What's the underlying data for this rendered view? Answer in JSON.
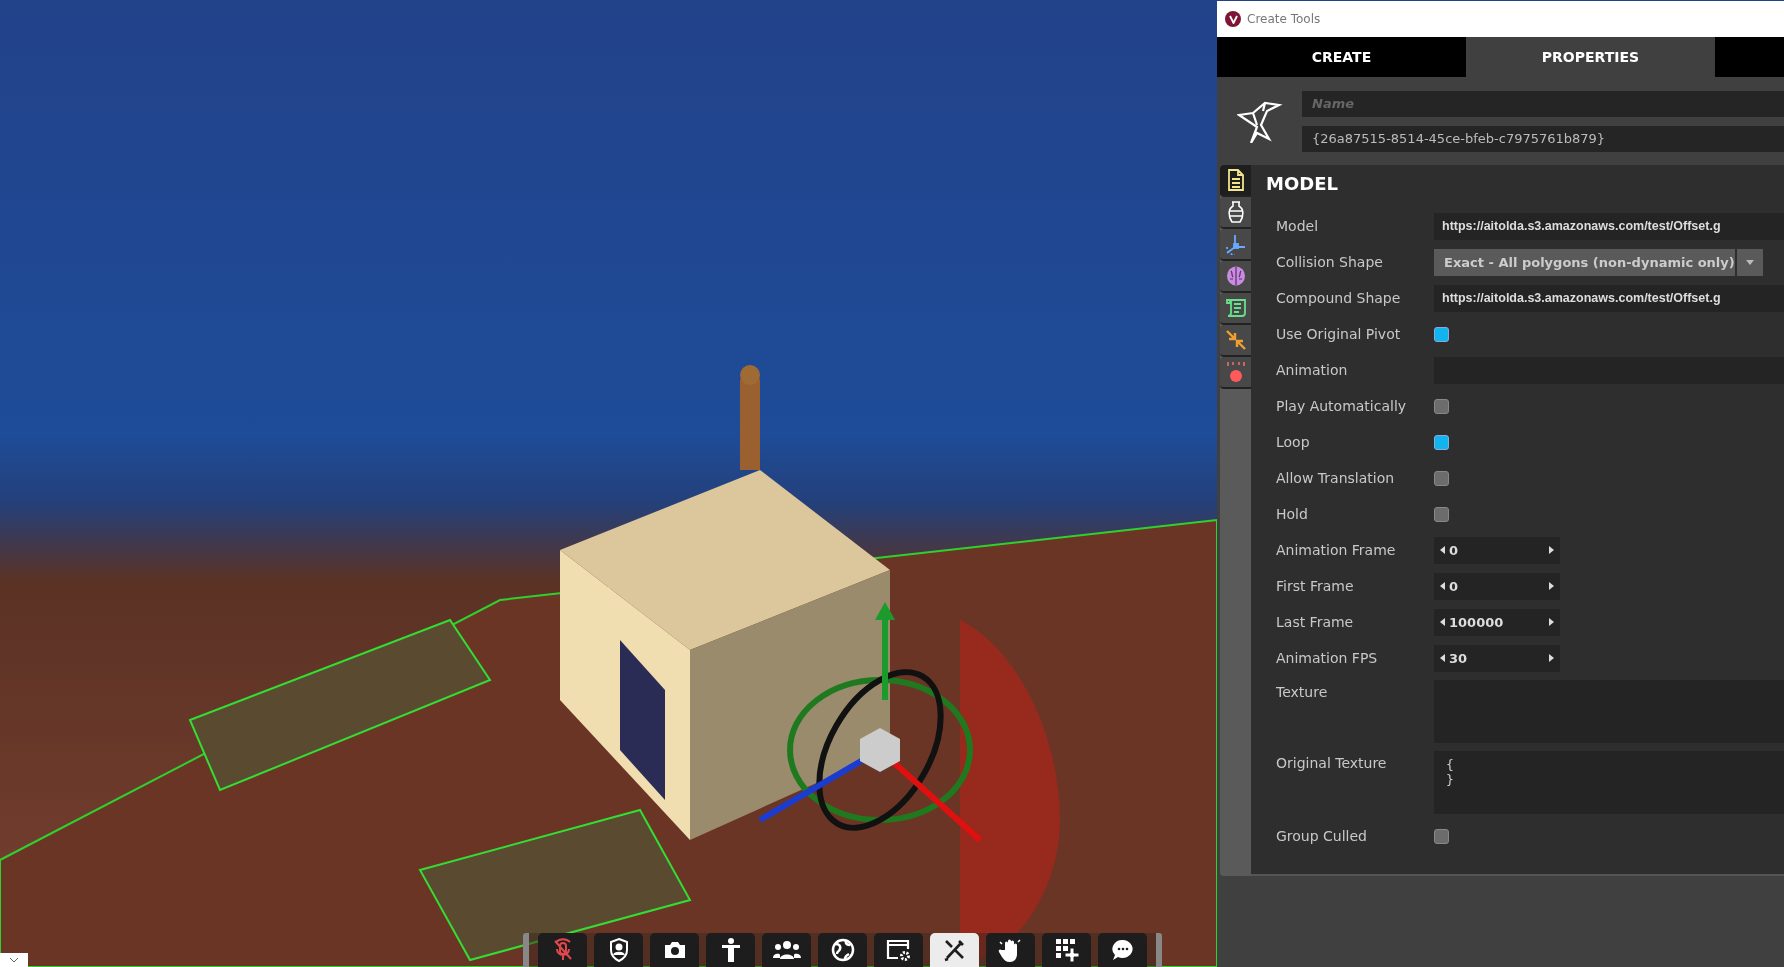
{
  "window": {
    "title": "Create Tools"
  },
  "tabs": [
    {
      "label": "CREATE",
      "selected": false
    },
    {
      "label": "PROPERTIES",
      "selected": true
    }
  ],
  "entity": {
    "name_placeholder": "Name",
    "id": "{26a87515-8514-45ce-bfeb-c7975761b879}"
  },
  "side_tabs": [
    {
      "kind": "document",
      "selected": true
    },
    {
      "kind": "vase",
      "selected": false
    },
    {
      "kind": "axes",
      "selected": false
    },
    {
      "kind": "brain",
      "selected": false
    },
    {
      "kind": "scroll",
      "selected": false
    },
    {
      "kind": "arrows",
      "selected": false
    },
    {
      "kind": "apple",
      "selected": false
    }
  ],
  "section": {
    "title": "MODEL"
  },
  "properties": [
    {
      "kind": "text",
      "label": "Model",
      "value": "https://aitolda.s3.amazonaws.com/test/Offset.g"
    },
    {
      "kind": "dropdown",
      "label": "Collision Shape",
      "value": "Exact - All polygons (non-dynamic only)"
    },
    {
      "kind": "text",
      "label": "Compound Shape",
      "value": "https://aitolda.s3.amazonaws.com/test/Offset.g"
    },
    {
      "kind": "checkbox",
      "label": "Use Original Pivot",
      "checked": true
    },
    {
      "kind": "text",
      "label": "Animation"
    },
    {
      "kind": "checkbox",
      "label": "Play Automatically",
      "checked": false
    },
    {
      "kind": "checkbox",
      "label": "Loop",
      "checked": true
    },
    {
      "kind": "checkbox",
      "label": "Allow Translation",
      "checked": false
    },
    {
      "kind": "checkbox",
      "label": "Hold",
      "checked": false
    },
    {
      "kind": "number",
      "label": "Animation Frame",
      "value": "0"
    },
    {
      "kind": "number",
      "label": "First Frame",
      "value": "0"
    },
    {
      "kind": "number",
      "label": "Last Frame",
      "value": "100000"
    },
    {
      "kind": "number",
      "label": "Animation FPS",
      "value": "30"
    },
    {
      "kind": "textarea",
      "label": "Texture"
    },
    {
      "kind": "textarea",
      "label": "Original Texture",
      "value": "{\n}"
    },
    {
      "kind": "checkbox",
      "label": "Group Culled",
      "checked": false
    }
  ],
  "toolbar": [
    {
      "kind": "mic",
      "muted": true,
      "selected": false
    },
    {
      "kind": "shield",
      "selected": false
    },
    {
      "kind": "camera",
      "selected": false
    },
    {
      "kind": "person",
      "selected": false
    },
    {
      "kind": "people",
      "selected": false
    },
    {
      "kind": "globe",
      "selected": false
    },
    {
      "kind": "window",
      "selected": false
    },
    {
      "kind": "tools",
      "selected": true
    },
    {
      "kind": "hand",
      "selected": false
    },
    {
      "kind": "grid",
      "selected": false
    },
    {
      "kind": "chat",
      "selected": false
    }
  ]
}
